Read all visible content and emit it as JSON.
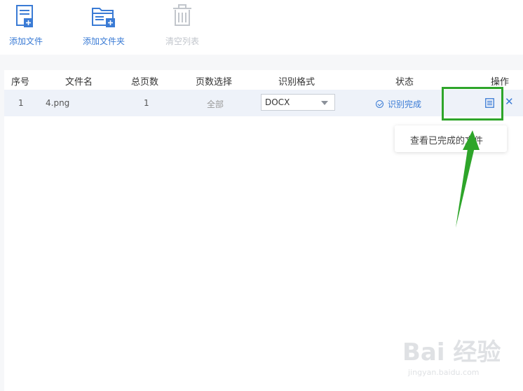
{
  "toolbar": {
    "add_file": "添加文件",
    "add_folder": "添加文件夹",
    "clear_list": "清空列表"
  },
  "table": {
    "headers": {
      "index": "序号",
      "filename": "文件名",
      "total_pages": "总页数",
      "page_select": "页数选择",
      "format": "识别格式",
      "status": "状态",
      "actions": "操作"
    },
    "rows": [
      {
        "index": "1",
        "filename": "4.png",
        "total_pages": "1",
        "page_select": "全部",
        "format": "DOCX",
        "status": "识别完成"
      }
    ]
  },
  "tooltip": {
    "text": "查看已完成的文件"
  },
  "watermark": {
    "brand": "Bai 经验",
    "url": "jingyan.baidu.com"
  },
  "colors": {
    "accent": "#3a7bd5",
    "highlight": "#2ea52a",
    "row_bg": "#eef2f9"
  }
}
